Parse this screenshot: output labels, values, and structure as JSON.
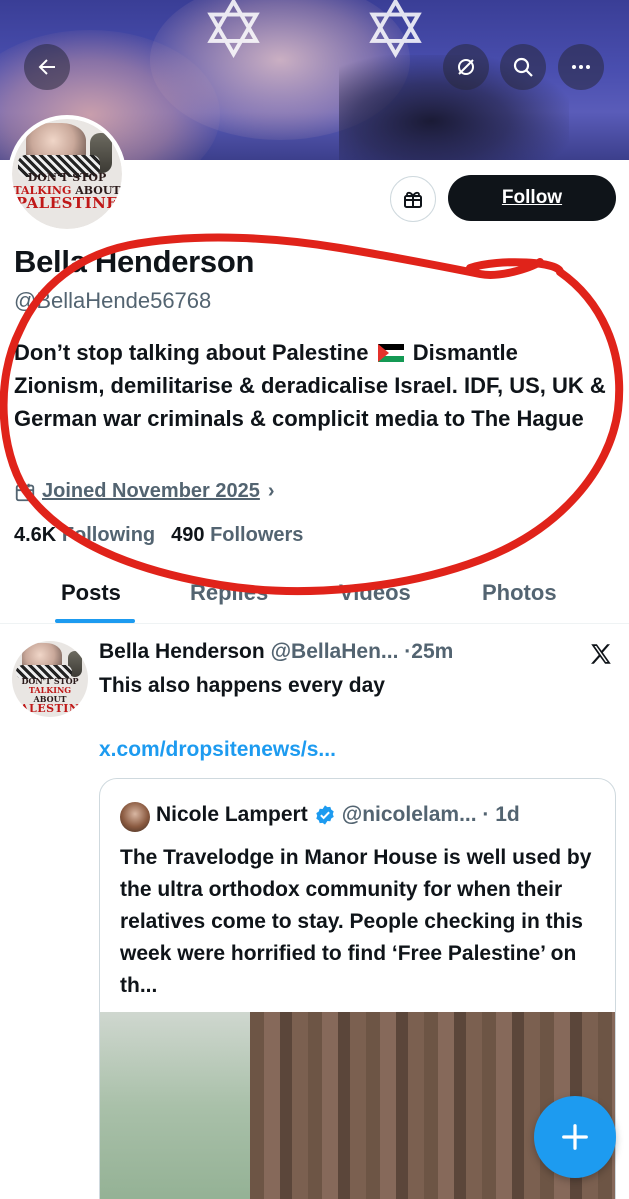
{
  "header": {
    "icons": [
      "back-arrow-icon",
      "grok-icon",
      "search-icon",
      "more-icon"
    ]
  },
  "profile": {
    "name": "Bella Henderson",
    "handle": "@BellaHende56768",
    "bio_part1": "Don’t stop talking about Palestine",
    "bio_part2": "Dismantle Zionism, demilitarise & deradicalise Israel. IDF, US, UK & German war criminals & complicit media to The Hague",
    "joined": "Joined November 2025",
    "following_count": "4.6K",
    "following_label": "Following",
    "followers_count": "490",
    "followers_label": "Followers",
    "follow_button": "Follow",
    "avatar_text": [
      "DON'T STOP",
      "TALKING",
      "ABOUT",
      "PALESTINE"
    ]
  },
  "tabs": [
    {
      "label": "Posts",
      "active": true
    },
    {
      "label": "Replies",
      "active": false
    },
    {
      "label": "Videos",
      "active": false
    },
    {
      "label": "Photos",
      "active": false
    }
  ],
  "post": {
    "author": "Bella Henderson",
    "handle": "@BellaHen...",
    "time": "25m",
    "text": "This also happens every day",
    "link": "x.com/dropsitenews/s...",
    "quote": {
      "author": "Nicole Lampert",
      "handle": "@nicolelam...",
      "time": "1d",
      "text": "The Travelodge in Manor House is well used by the ultra orthodox community for when their relatives come to stay. People checking in this week were horrified to find ‘Free Palestine’ on th..."
    }
  },
  "colors": {
    "accent": "#1d9bf0",
    "text": "#0f1419",
    "muted": "#536471",
    "annotation": "#e0231a"
  }
}
